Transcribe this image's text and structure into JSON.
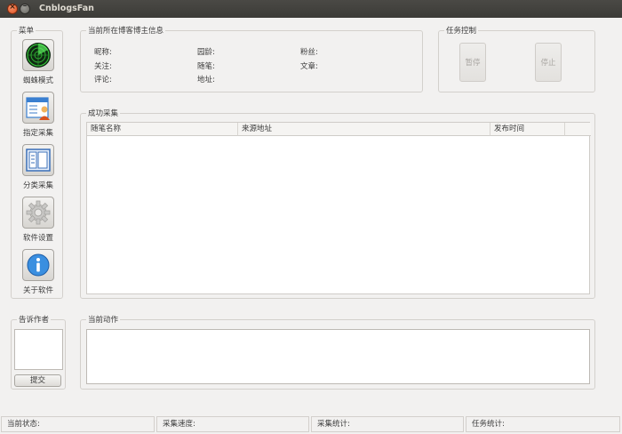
{
  "window": {
    "title": "CnblogsFan"
  },
  "menu": {
    "title": "菜单",
    "items": [
      {
        "label": "蜘蛛模式",
        "icon": "radar-icon"
      },
      {
        "label": "指定采集",
        "icon": "user-form-icon"
      },
      {
        "label": "分类采集",
        "icon": "category-list-icon"
      },
      {
        "label": "软件设置",
        "icon": "gear-icon"
      },
      {
        "label": "关于软件",
        "icon": "info-icon"
      }
    ]
  },
  "blogger": {
    "title": "当前所在博客博主信息",
    "nickname": "昵称:",
    "age": "园龄:",
    "fans": "粉丝:",
    "follow": "关注:",
    "essays": "随笔:",
    "articles": "文章:",
    "comments": "评论:",
    "address": "地址:"
  },
  "task": {
    "title": "任务控制",
    "pause": "暂停",
    "stop": "停止"
  },
  "results": {
    "title": "成功采集",
    "columns": [
      "随笔名称",
      "来源地址",
      "发布时间"
    ]
  },
  "feedback": {
    "title": "告诉作者",
    "submit": "提交"
  },
  "current_action": {
    "title": "当前动作"
  },
  "status": {
    "state": "当前状态:",
    "speed": "采集速度:",
    "stats": "采集统计:",
    "task_stats": "任务统计:"
  },
  "colors": {
    "icon_blue": "#3a7fd0",
    "radar_green": "#39d23c",
    "close_orange": "#e0501f"
  }
}
